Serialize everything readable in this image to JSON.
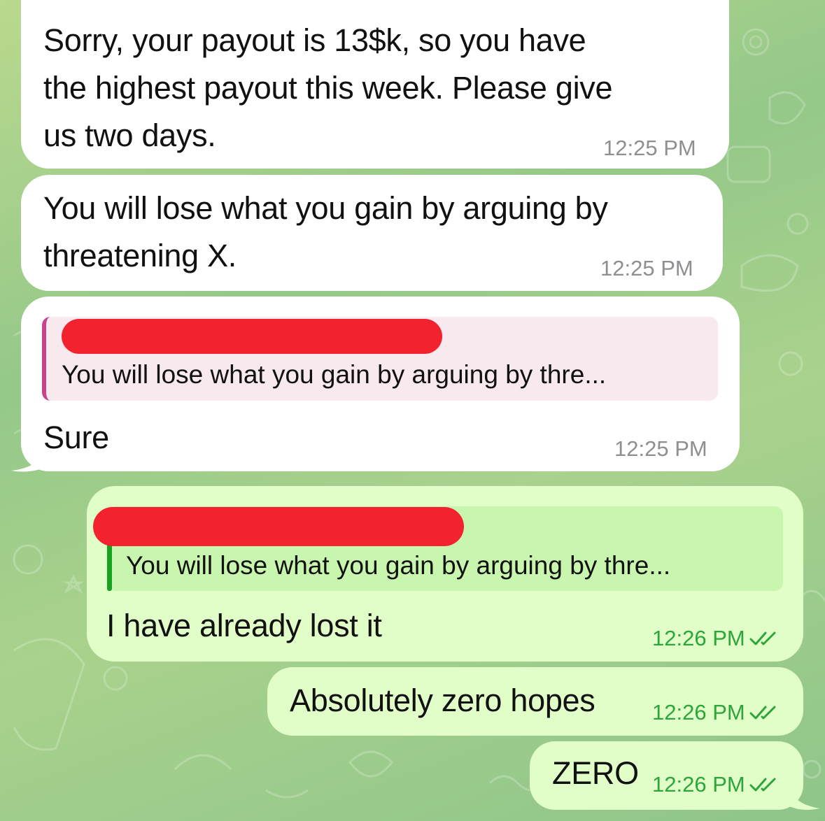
{
  "colors": {
    "incoming_bubble": "#ffffff",
    "outgoing_bubble": "#e1fdc8",
    "incoming_reply_accent": "#c6448a",
    "outgoing_reply_accent": "#17a21f",
    "outgoing_time": "#2ea53b",
    "redaction": "#f2222f"
  },
  "messages": [
    {
      "direction": "incoming",
      "text_lines": [
        "Sorry, your payout is 13$k, so you have",
        "the highest payout this week. Please give",
        "us two days."
      ],
      "time": "12:25 PM"
    },
    {
      "direction": "incoming",
      "text_lines": [
        "You will lose what you gain by arguing by",
        "threatening X."
      ],
      "time": "12:25 PM"
    },
    {
      "direction": "incoming",
      "reply_preview": "You will lose what you gain by arguing by thre...",
      "text": "Sure",
      "time": "12:25 PM"
    },
    {
      "direction": "outgoing",
      "reply_preview": "You will lose what you gain by arguing by thre...",
      "text": "I have already lost it",
      "time": "12:26 PM",
      "status_icon": "double-check-icon"
    },
    {
      "direction": "outgoing",
      "text": "Absolutely zero hopes",
      "time": "12:26 PM",
      "status_icon": "double-check-icon"
    },
    {
      "direction": "outgoing",
      "text": "ZERO",
      "time": "12:26 PM",
      "status_icon": "double-check-icon"
    }
  ]
}
